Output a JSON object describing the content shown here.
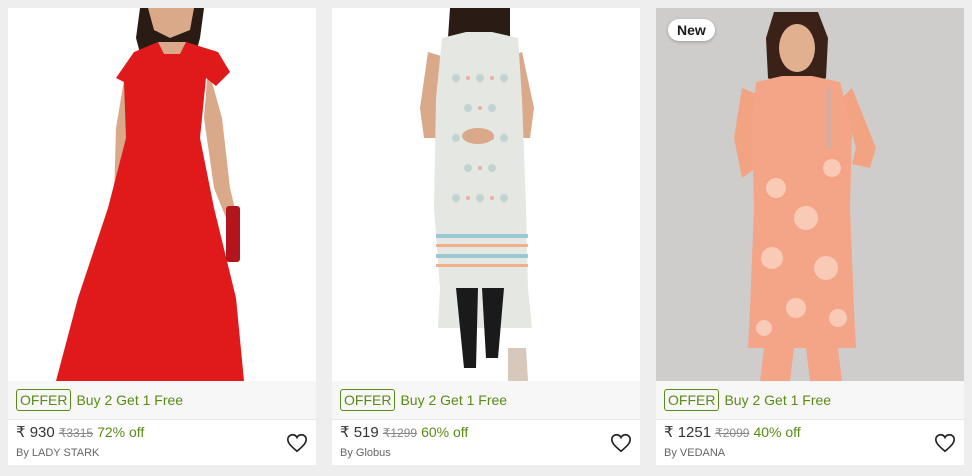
{
  "products": [
    {
      "offer_tag": "OFFER",
      "offer_text": "Buy 2 Get 1 Free",
      "price": "₹ 930",
      "mrp": "₹3315",
      "discount": "72% off",
      "brand": "By LADY STARK",
      "image_description_icon": "red-maxi-dress-image",
      "wishlist_icon": "heart-icon"
    },
    {
      "offer_tag": "OFFER",
      "offer_text": "Buy 2 Get 1 Free",
      "price": "₹ 519",
      "mrp": "₹1299",
      "discount": "60% off",
      "brand": "By Globus",
      "image_description_icon": "printed-kurta-image",
      "wishlist_icon": "heart-icon"
    },
    {
      "badge": "New",
      "offer_tag": "OFFER",
      "offer_text": "Buy 2 Get 1 Free",
      "price": "₹ 1251",
      "mrp": "₹2099",
      "discount": "40% off",
      "brand": "By VEDANA",
      "image_description_icon": "peach-kurta-set-image",
      "wishlist_icon": "heart-icon"
    }
  ],
  "colors": {
    "offer_green": "#5a8a16",
    "background": "#eeeeee"
  }
}
